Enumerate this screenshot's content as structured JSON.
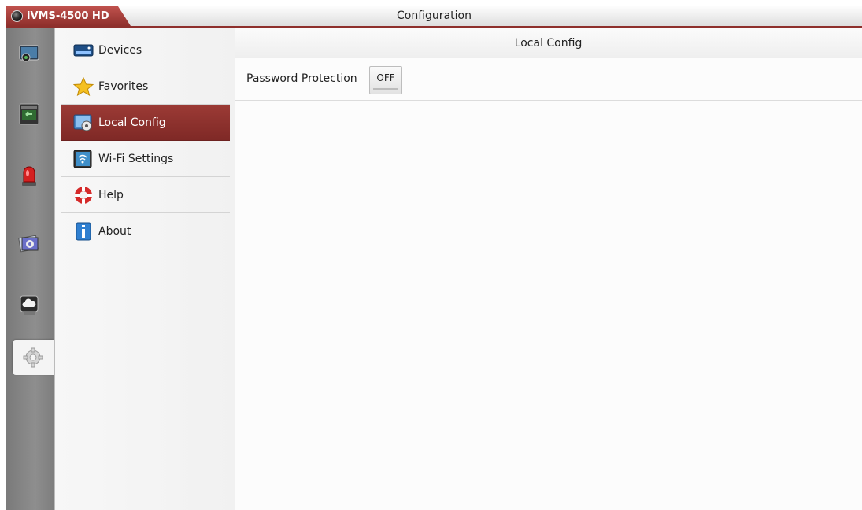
{
  "app": {
    "name": "iVMS-4500 HD",
    "window_title": "Configuration",
    "accent": "#8e2f2c"
  },
  "rail": {
    "items": [
      {
        "icon": "live-view-icon"
      },
      {
        "icon": "playback-icon"
      },
      {
        "icon": "alarm-icon"
      },
      {
        "icon": "picture-video-icon"
      },
      {
        "icon": "cloud-icon"
      },
      {
        "icon": "configuration-gear-icon",
        "active": true
      }
    ]
  },
  "menu": {
    "items": [
      {
        "label": "Devices",
        "icon": "devices-icon"
      },
      {
        "label": "Favorites",
        "icon": "star-icon"
      },
      {
        "label": "Local Config",
        "icon": "local-config-icon",
        "selected": true
      },
      {
        "label": "Wi-Fi Settings",
        "icon": "wifi-settings-icon"
      },
      {
        "label": "Help",
        "icon": "lifebuoy-icon"
      },
      {
        "label": "About",
        "icon": "info-icon"
      }
    ]
  },
  "content": {
    "header": "Local Config",
    "password_protection": {
      "label": "Password Protection",
      "state": "OFF"
    }
  }
}
